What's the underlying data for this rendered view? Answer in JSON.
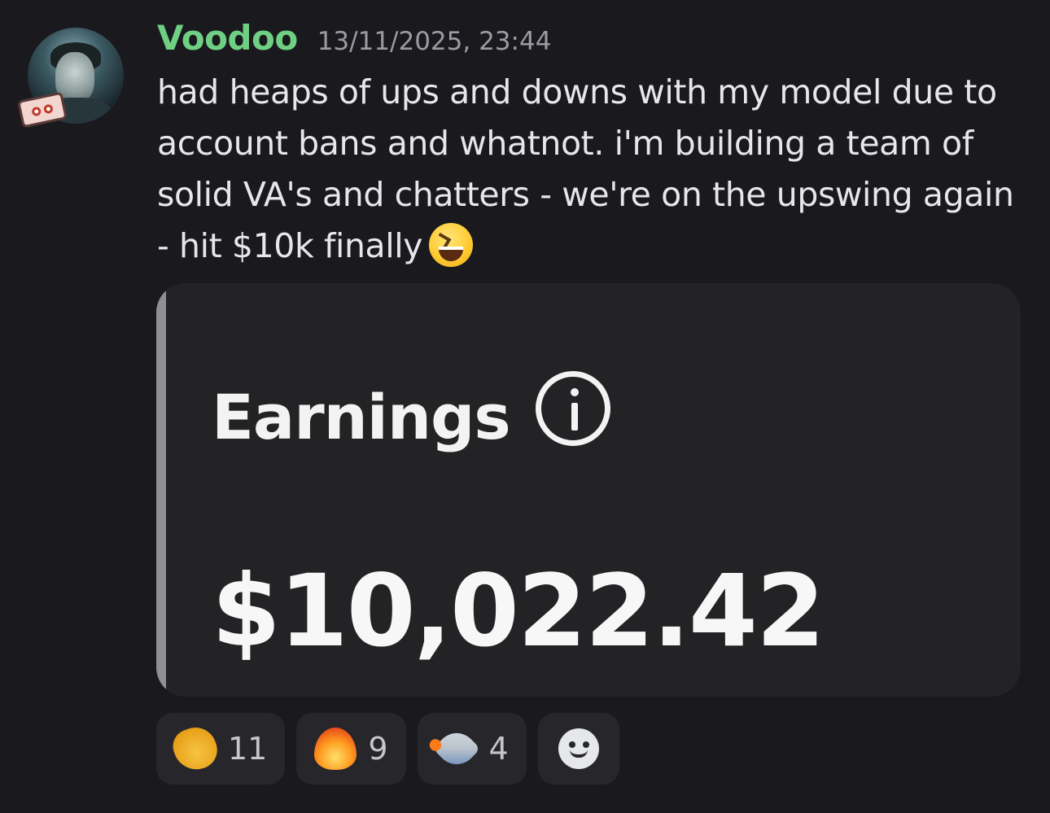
{
  "message": {
    "author": "Voodoo",
    "timestamp": "13/11/2025, 23:44",
    "text": "had heaps of ups and downs with my model due to account bans and whatnot. i'm building a team of solid VA's and chatters - we're on the upswing again - hit $10k finally",
    "inline_emoji": "laughing-face"
  },
  "embed": {
    "title": "Earnings",
    "amount": "$10,022.42"
  },
  "reactions": [
    {
      "emoji": "clapping-hands",
      "count": "11"
    },
    {
      "emoji": "fire",
      "count": "9"
    },
    {
      "emoji": "rocket",
      "count": "4"
    }
  ],
  "colors": {
    "background": "#1a1a1e",
    "username": "#6fd083",
    "embed_bg": "#232325",
    "reaction_bg": "#27272b"
  }
}
